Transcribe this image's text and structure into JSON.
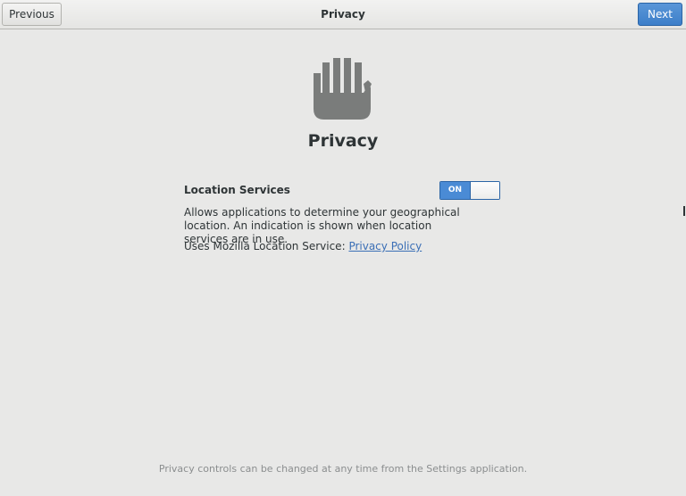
{
  "header": {
    "title": "Privacy",
    "previous_label": "Previous",
    "next_label": "Next"
  },
  "main": {
    "icon": "hand-icon",
    "title": "Privacy",
    "location_services": {
      "label": "Location Services",
      "toggle_state": "ON",
      "description": "Allows applications to determine your geographical location. An indication is shown when location services are in use.",
      "uses_text": "Uses Mozilla Location Service: ",
      "policy_link": "Privacy Policy"
    }
  },
  "footer": {
    "note": "Privacy controls can be changed at any time from the Settings application."
  },
  "colors": {
    "accent": "#4a8bd5",
    "background": "#e8e8e7",
    "link": "#3b6fb6"
  }
}
